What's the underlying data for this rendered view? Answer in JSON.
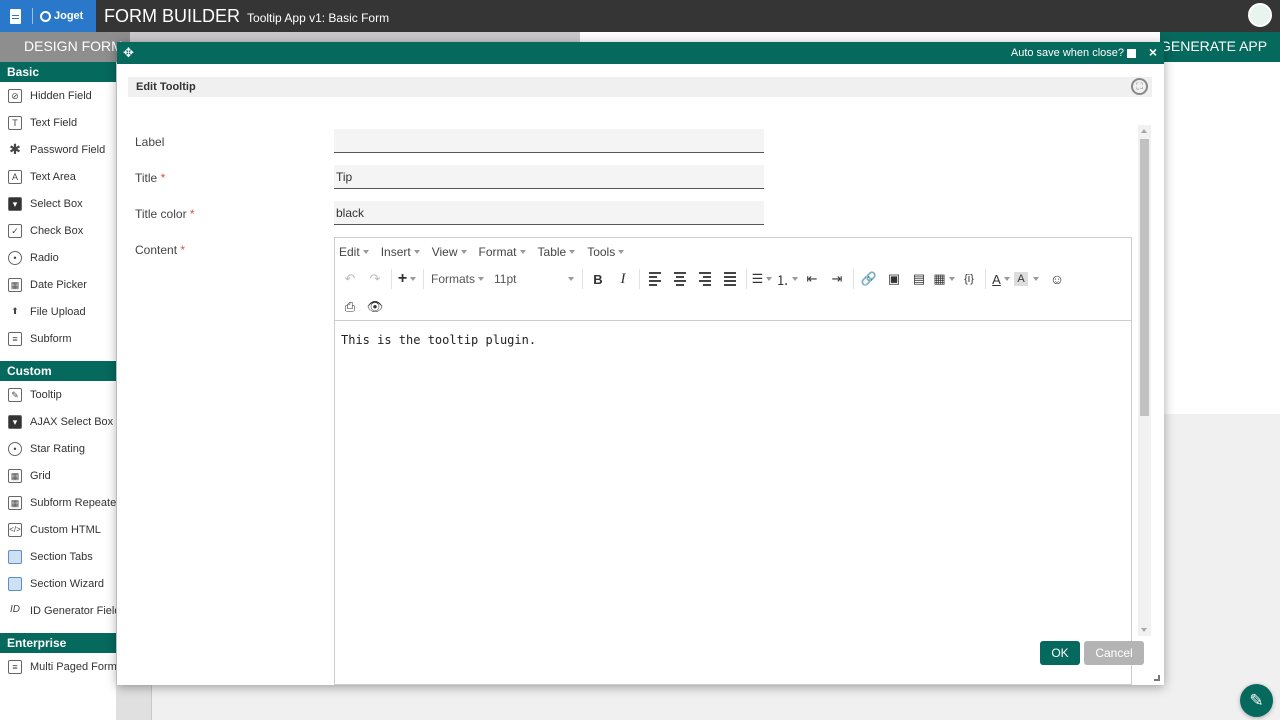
{
  "topbar": {
    "brand": "Joget",
    "title": "FORM BUILDER",
    "subtitle": "Tooltip App v1: Basic Form"
  },
  "steps": {
    "design": "DESIGN FORM",
    "generate": "GENERATE APP"
  },
  "palette": {
    "basic": {
      "heading": "Basic",
      "items": [
        "Hidden Field",
        "Text Field",
        "Password Field",
        "Text Area",
        "Select Box",
        "Check Box",
        "Radio",
        "Date Picker",
        "File Upload",
        "Subform"
      ]
    },
    "custom": {
      "heading": "Custom",
      "items": [
        "Tooltip",
        "AJAX Select Box",
        "Star Rating",
        "Grid",
        "Subform Repeater",
        "Custom HTML",
        "Section Tabs",
        "Section Wizard",
        "ID Generator Field"
      ]
    },
    "enterprise": {
      "heading": "Enterprise",
      "items": [
        "Multi Paged Form"
      ]
    }
  },
  "dialog": {
    "autosave_label": "Auto save when close?",
    "close_glyph": "×",
    "header": "Edit Tooltip",
    "fields": {
      "label": {
        "label": "Label",
        "value": ""
      },
      "title": {
        "label": "Title",
        "value": "Tip"
      },
      "title_color": {
        "label": "Title color",
        "value": "black"
      },
      "content": {
        "label": "Content"
      }
    },
    "required_mark": "*",
    "editor": {
      "menus": [
        "Edit",
        "Insert",
        "View",
        "Format",
        "Table",
        "Tools"
      ],
      "formats_label": "Formats",
      "font_size": "11pt",
      "content": "This is the tooltip plugin."
    },
    "ok_label": "OK",
    "cancel_label": "Cancel"
  }
}
